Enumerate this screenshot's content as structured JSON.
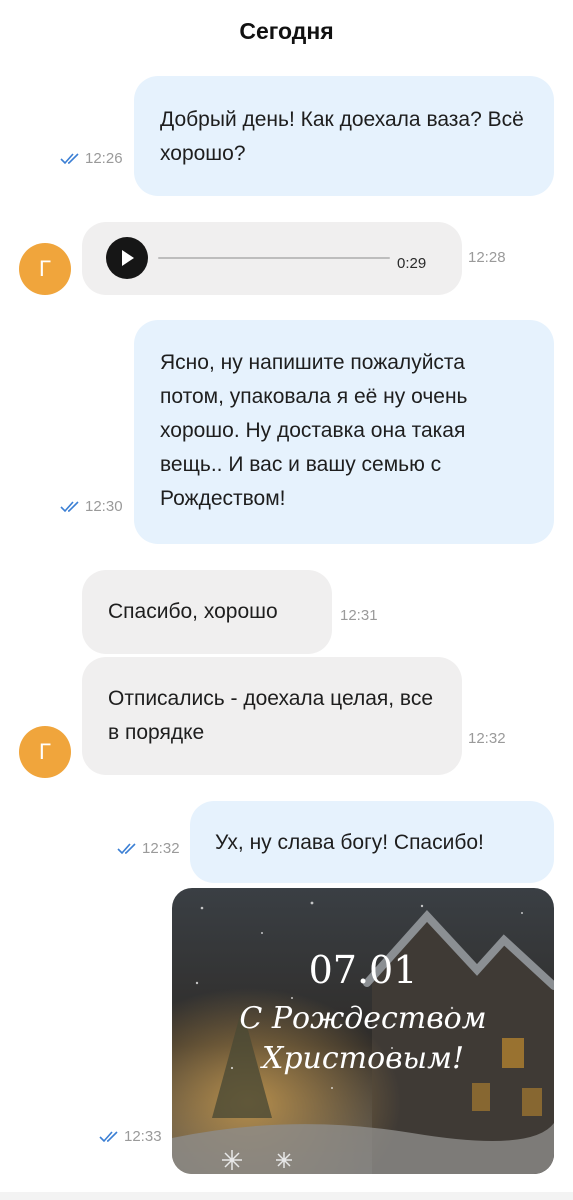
{
  "chat": {
    "day_separator": "Сегодня",
    "avatar_letter": "Г",
    "messages": [
      {
        "direction": "out",
        "text": "Добрый день! Как доехала ваза? Всё хорошо?",
        "time": "12:26"
      },
      {
        "direction": "in",
        "type": "voice",
        "duration": "0:29",
        "time": "12:28"
      },
      {
        "direction": "out",
        "text": "Ясно, ну напишите пожалуйста потом, упаковала я её ну очень хорошо. Ну доставка она такая вещь.. И вас и вашу семью с Рождеством!",
        "time": "12:30"
      },
      {
        "direction": "in",
        "text": "Спасибо, хорошо",
        "time": "12:31"
      },
      {
        "direction": "in",
        "text": "Отписались - доехала целая, все в порядке",
        "time": "12:32"
      },
      {
        "direction": "out",
        "text": "Ух, ну слава богу! Спасибо!",
        "time": "12:32"
      },
      {
        "direction": "out",
        "type": "image",
        "time": "12:33",
        "image_text": {
          "date": "07.01",
          "line1": "С Рождеством",
          "line2": "Христовым!"
        }
      }
    ]
  },
  "colors": {
    "outgoing_bubble": "#e6f2fd",
    "incoming_bubble": "#f0efef",
    "avatar": "#f0a53c",
    "read_ticks": "#3b7fd4"
  },
  "icons": {
    "play": "play-icon",
    "read_status": "double-check-icon",
    "snowflake": "snowflake-icon"
  }
}
